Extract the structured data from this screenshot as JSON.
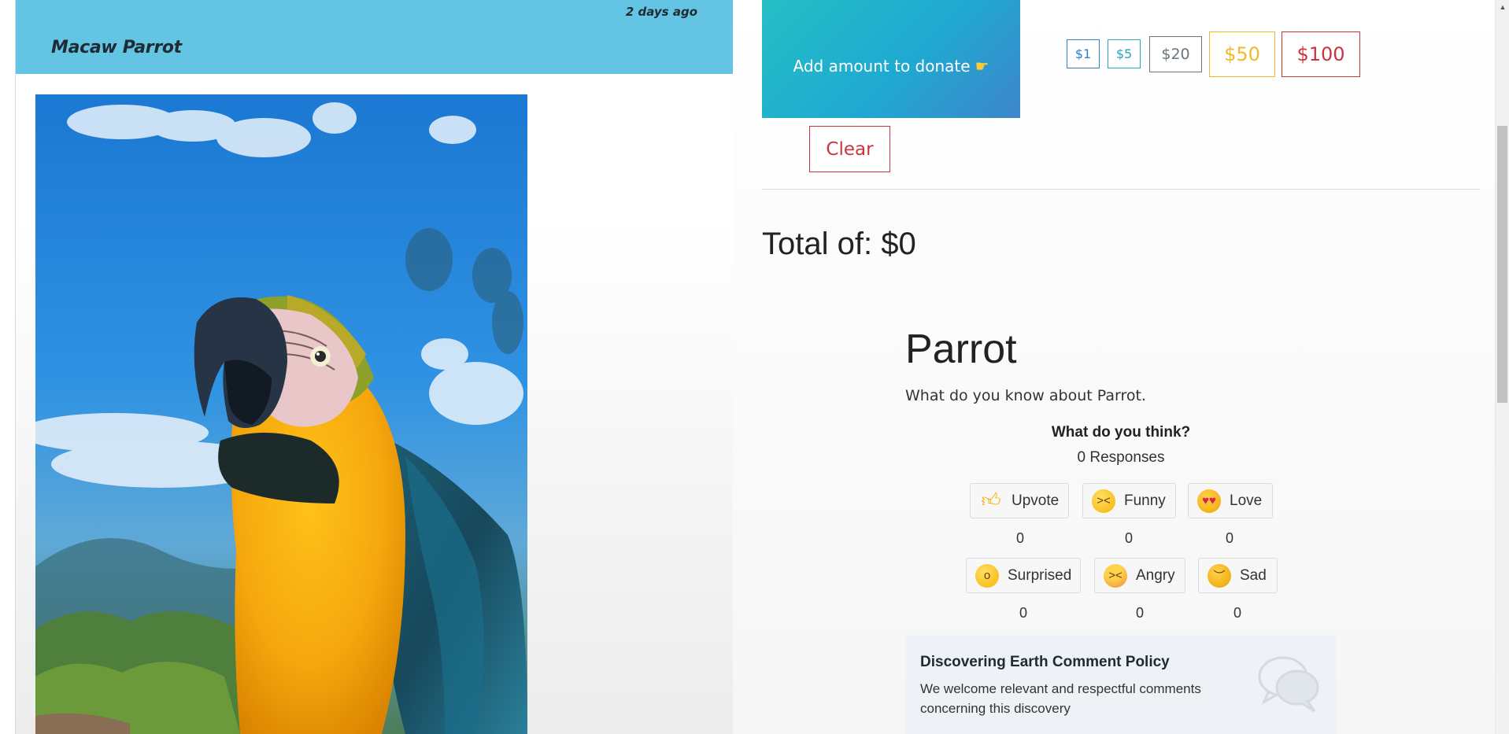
{
  "post": {
    "time_ago": "2 days ago",
    "title": "Macaw Parrot",
    "image_alt": "Blue-and-yellow macaw parrot against a blue sky"
  },
  "donate": {
    "prompt": "Add amount to donate",
    "hand_icon": "pointing-hand-icon",
    "amounts": [
      "$1",
      "$5",
      "$20",
      "$50",
      "$100"
    ],
    "clear_label": "Clear",
    "total_label": "Total of: $0"
  },
  "article": {
    "title": "Parrot",
    "description": "What do you know about Parrot."
  },
  "reactions": {
    "heading": "What do you think?",
    "responses": "0 Responses",
    "items": [
      {
        "label": "Upvote",
        "count": "0",
        "icon": "thumbs-up-icon"
      },
      {
        "label": "Funny",
        "count": "0",
        "icon": "funny-face-icon"
      },
      {
        "label": "Love",
        "count": "0",
        "icon": "heart-eyes-icon"
      },
      {
        "label": "Surprised",
        "count": "0",
        "icon": "surprised-face-icon"
      },
      {
        "label": "Angry",
        "count": "0",
        "icon": "angry-face-icon"
      },
      {
        "label": "Sad",
        "count": "0",
        "icon": "sad-face-icon"
      }
    ]
  },
  "policy": {
    "title": "Discovering Earth Comment Policy",
    "text": "We welcome relevant and respectful comments concerning this discovery"
  },
  "colors": {
    "header_bg": "#63c5e3",
    "danger": "#c9343f",
    "warning": "#f0b92a",
    "primary": "#2d7fc7",
    "info": "#2aa3bf",
    "secondary": "#6c757d"
  }
}
